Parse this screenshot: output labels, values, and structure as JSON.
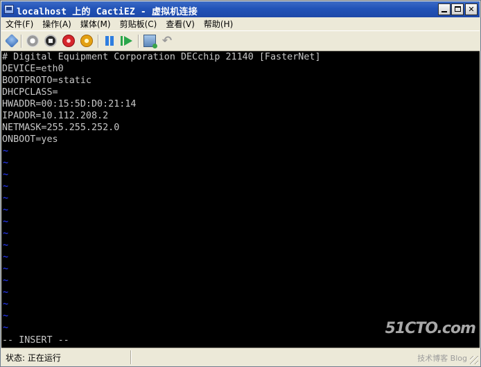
{
  "window": {
    "title": "localhost 上的 CactiEZ - 虚拟机连接"
  },
  "titlebar_buttons": {
    "close_glyph": "✕"
  },
  "menu": {
    "items": [
      "文件(F)",
      "操作(A)",
      "媒体(M)",
      "剪贴板(C)",
      "查看(V)",
      "帮助(H)"
    ]
  },
  "toolbar": {
    "revert_glyph": "↶"
  },
  "terminal": {
    "lines": [
      "# Digital Equipment Corporation DECchip 21140 [FasterNet]",
      "DEVICE=eth0",
      "BOOTPROTO=static",
      "DHCPCLASS=",
      "HWADDR=00:15:5D:D0:21:14",
      "IPADDR=10.112.208.2",
      "NETMASK=255.255.252.0",
      "ONBOOT=yes"
    ],
    "tilde": "~",
    "mode_line": "-- INSERT --",
    "colors": {
      "background": "#000000",
      "text": "#c8c8c8",
      "tilde": "#1f2fd0"
    }
  },
  "watermark": {
    "logo": "51CTO.com",
    "subtitle": "技术博客 Blog"
  },
  "status": {
    "text": "状态: 正在运行"
  }
}
